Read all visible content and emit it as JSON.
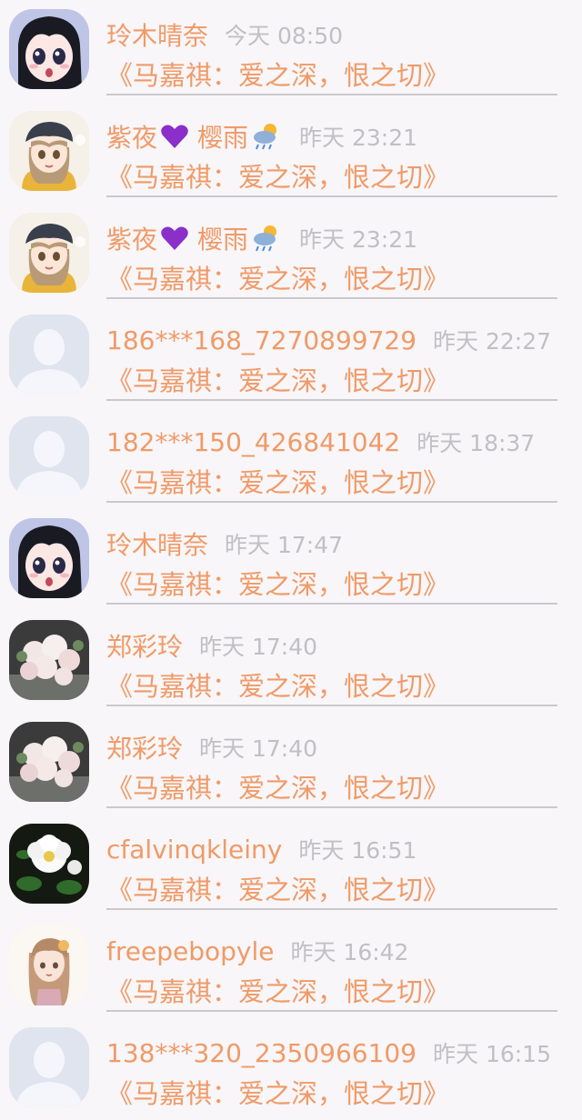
{
  "comments": [
    {
      "avatar": "anime-girl-avatar",
      "name": "玲木晴奈",
      "time": "今天 08:50",
      "subject": "《马嘉祺：爱之深，恨之切》"
    },
    {
      "avatar": "anime-girl-beret-avatar",
      "name_a": "紫夜",
      "emoji_a": "purple-heart",
      "name_b": "樱雨",
      "emoji_b": "sun-rain-cloud",
      "time": "昨天 23:21",
      "subject": "《马嘉祺：爱之深，恨之切》"
    },
    {
      "avatar": "anime-girl-beret-avatar",
      "name_a": "紫夜",
      "emoji_a": "purple-heart",
      "name_b": "樱雨",
      "emoji_b": "sun-rain-cloud",
      "time": "昨天 23:21",
      "subject": "《马嘉祺：爱之深，恨之切》"
    },
    {
      "avatar": "default-user-avatar",
      "name": "186***168_7270899729",
      "time": "昨天 22:27",
      "subject": "《马嘉祺：爱之深，恨之切》"
    },
    {
      "avatar": "default-user-avatar",
      "name": "182***150_426841042",
      "time": "昨天 18:37",
      "subject": "《马嘉祺：爱之深，恨之切》"
    },
    {
      "avatar": "anime-girl-avatar",
      "name": "玲木晴奈",
      "time": "昨天 17:47",
      "subject": "《马嘉祺：爱之深，恨之切》"
    },
    {
      "avatar": "flower-bouquet-avatar",
      "name": "郑彩玲",
      "time": "昨天 17:40",
      "subject": "《马嘉祺：爱之深，恨之切》"
    },
    {
      "avatar": "flower-bouquet-avatar",
      "name": "郑彩玲",
      "time": "昨天 17:40",
      "subject": "《马嘉祺：爱之深，恨之切》"
    },
    {
      "avatar": "white-peony-avatar",
      "name": "cfalvinqkleiny",
      "time": "昨天 16:51",
      "subject": "《马嘉祺：爱之深，恨之切》"
    },
    {
      "avatar": "illustrated-girl-avatar",
      "name": "freepebopyle",
      "time": "昨天 16:42",
      "subject": "《马嘉祺：爱之深，恨之切》"
    },
    {
      "avatar": "default-user-avatar",
      "name": "138***320_2350966109",
      "time": "昨天 16:15",
      "subject": "《马嘉祺：爱之深，恨之切》"
    }
  ],
  "colors": {
    "accent": "#f09a68",
    "time": "#c0c0c4",
    "divider": "#c9c9cc",
    "background": "#f8f6f8"
  }
}
